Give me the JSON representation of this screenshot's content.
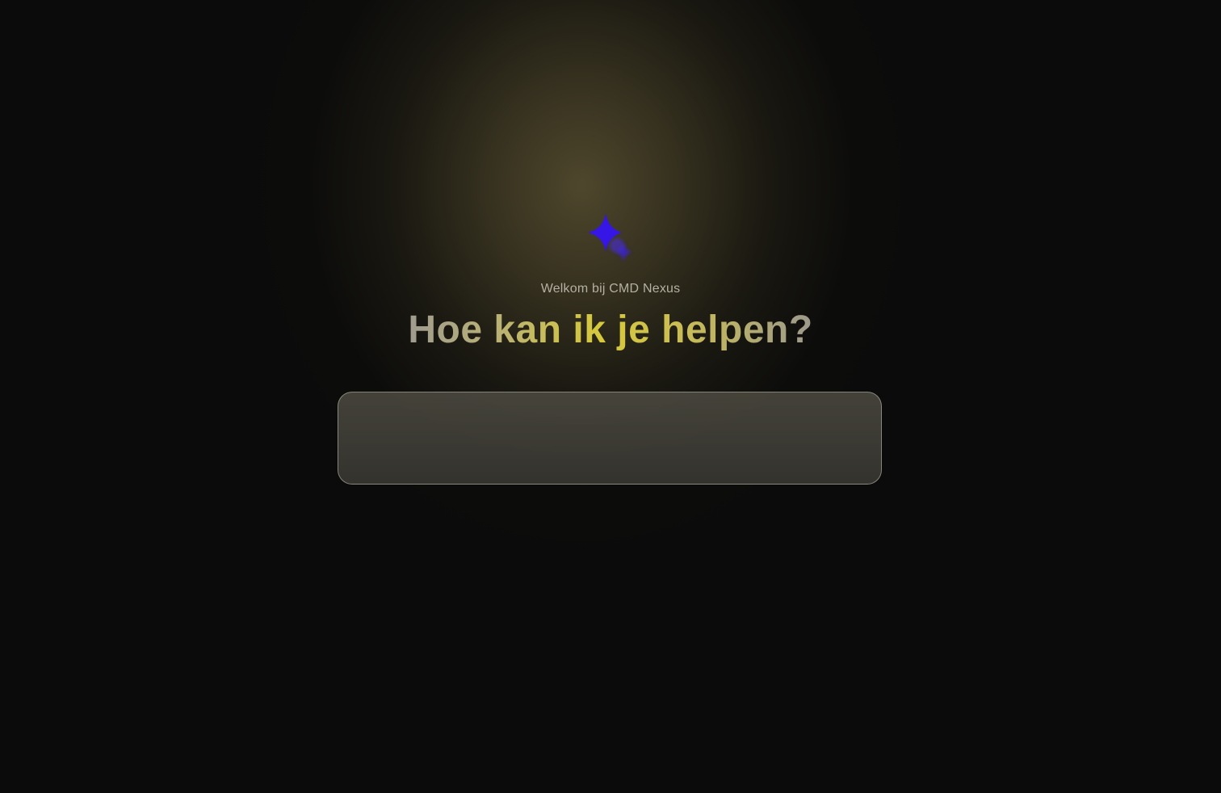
{
  "header": {
    "welcome_text": "Welkom bij CMD Nexus",
    "headline": "Hoe kan ik je helpen?"
  },
  "logo": {
    "icon": "sparkle-icon",
    "color": "#3a1fe0"
  },
  "chat": {
    "input_value": "",
    "placeholder": ""
  },
  "colors": {
    "background": "#0b0b0b",
    "glow": "#524a2e",
    "headline_accent": "#d7c93a"
  }
}
